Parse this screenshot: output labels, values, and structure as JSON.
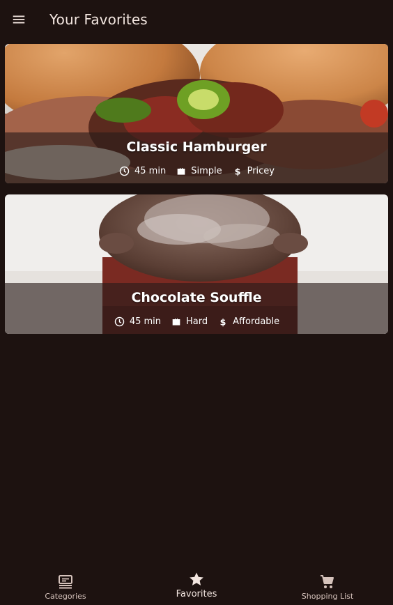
{
  "appbar": {
    "title": "Your Favorites",
    "menu_icon": "menu-icon"
  },
  "meals": [
    {
      "title": "Classic Hamburger",
      "duration": "45 min",
      "complexity": "Simple",
      "affordability": "Pricey"
    },
    {
      "title": "Chocolate Souffle",
      "duration": "45 min",
      "complexity": "Hard",
      "affordability": "Affordable"
    }
  ],
  "bottom_nav": {
    "items": [
      {
        "label": "Categories",
        "icon": "set-meal-icon"
      },
      {
        "label": "Favorites",
        "icon": "star-icon",
        "active": true
      },
      {
        "label": "Shopping List",
        "icon": "shopping-cart-icon"
      }
    ]
  },
  "colors": {
    "background": "#1d1210",
    "text": "#f3e6e0",
    "overlay": "#281c1a"
  }
}
